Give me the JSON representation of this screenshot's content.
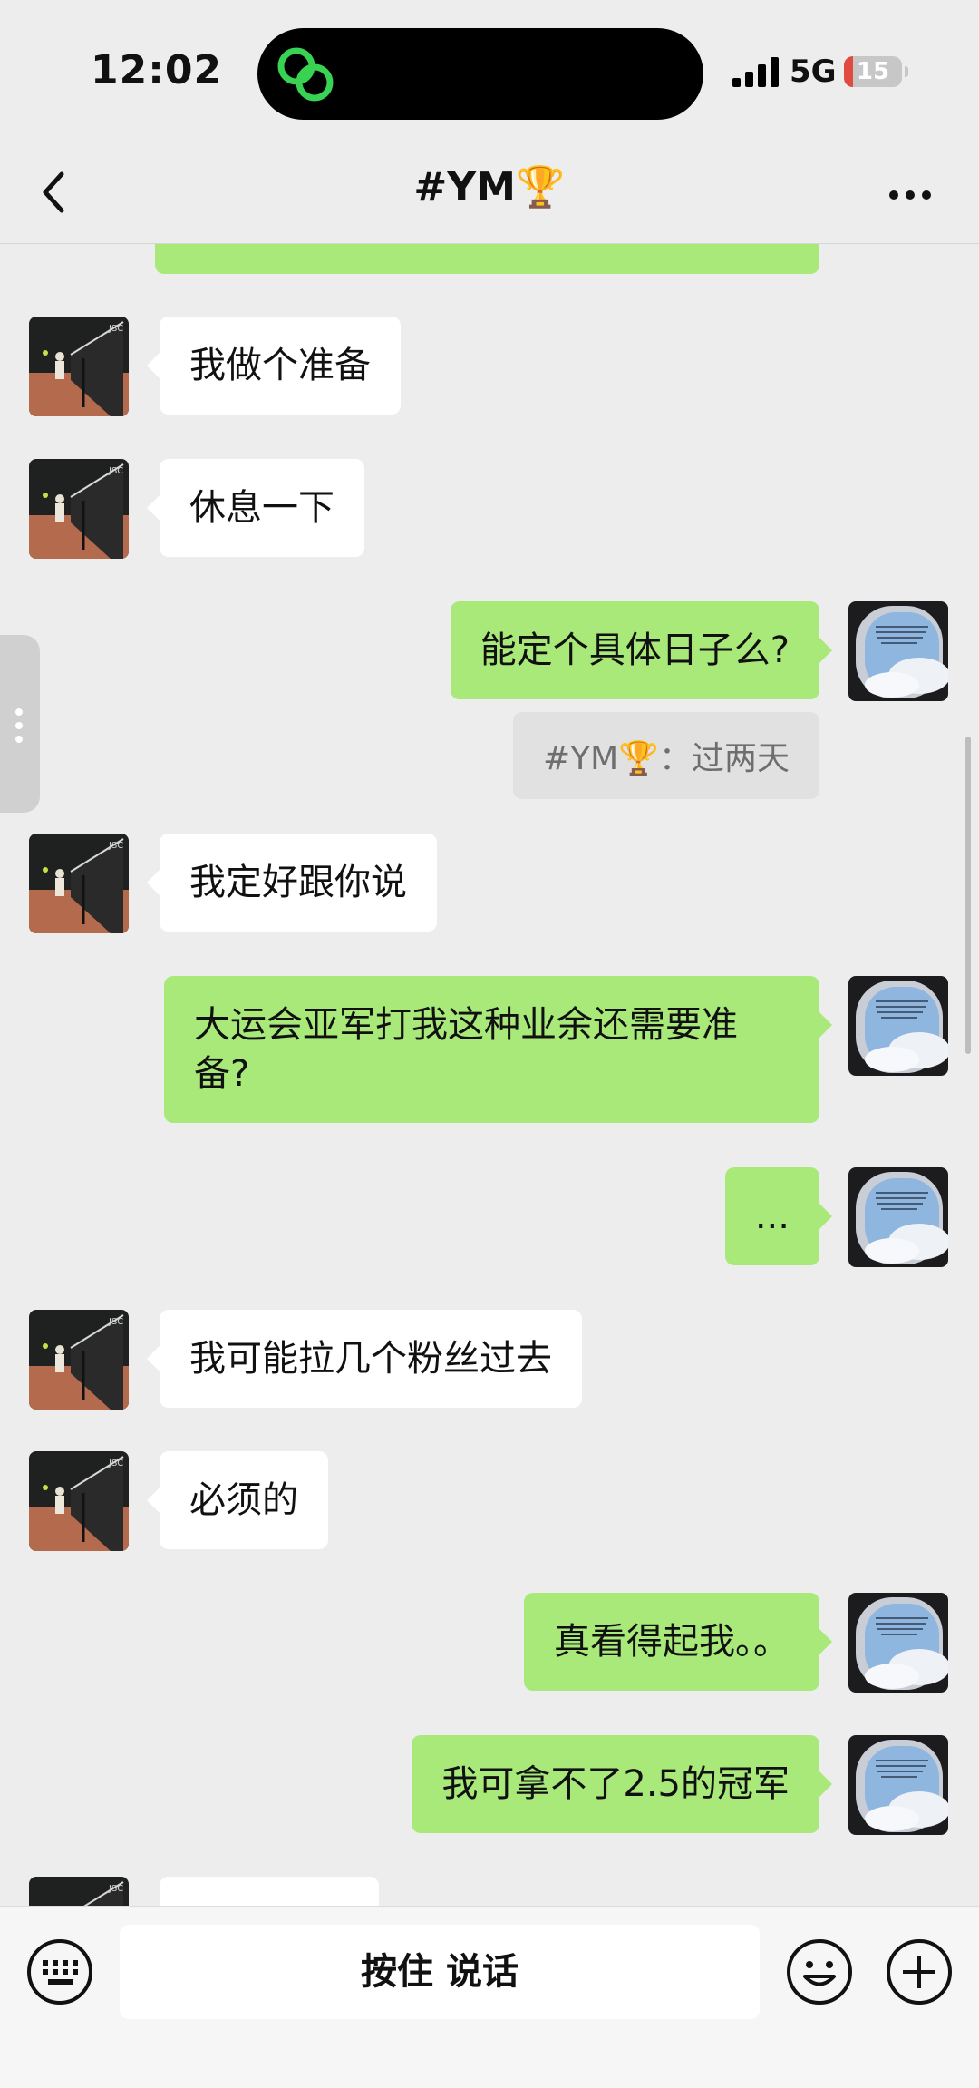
{
  "status_bar": {
    "time": "12:02",
    "network": "5G",
    "battery": "15",
    "battery_level": 0.15
  },
  "nav": {
    "title": "#YM🏆",
    "back_icon": "chevron-left-icon",
    "more_icon": "ellipsis-icon"
  },
  "messages": [
    {
      "side": "left",
      "text": "我做个准备"
    },
    {
      "side": "left",
      "text": "休息一下"
    },
    {
      "side": "right",
      "text": "能定个具体日子么?"
    },
    {
      "side": "quote",
      "text": "#YM🏆：过两天"
    },
    {
      "side": "left",
      "text": "我定好跟你说"
    },
    {
      "side": "right",
      "text": "大运会亚军打我这种业余还需要准备?"
    },
    {
      "side": "right",
      "text": "..."
    },
    {
      "side": "left",
      "text": "我可能拉几个粉丝过去"
    },
    {
      "side": "left",
      "text": "必须的"
    },
    {
      "side": "right",
      "text": "真看得起我。。"
    },
    {
      "side": "right",
      "text": "我可拿不了2.5的冠军"
    }
  ],
  "input_bar": {
    "voice_label": "按住 说话",
    "keyboard_icon": "keyboard-icon",
    "emoji_icon": "emoji-icon",
    "plus_icon": "plus-icon"
  },
  "colors": {
    "background": "#ededed",
    "bubble_sent": "#a9e97a",
    "bubble_received": "#ffffff",
    "island_icon": "#39d353"
  }
}
